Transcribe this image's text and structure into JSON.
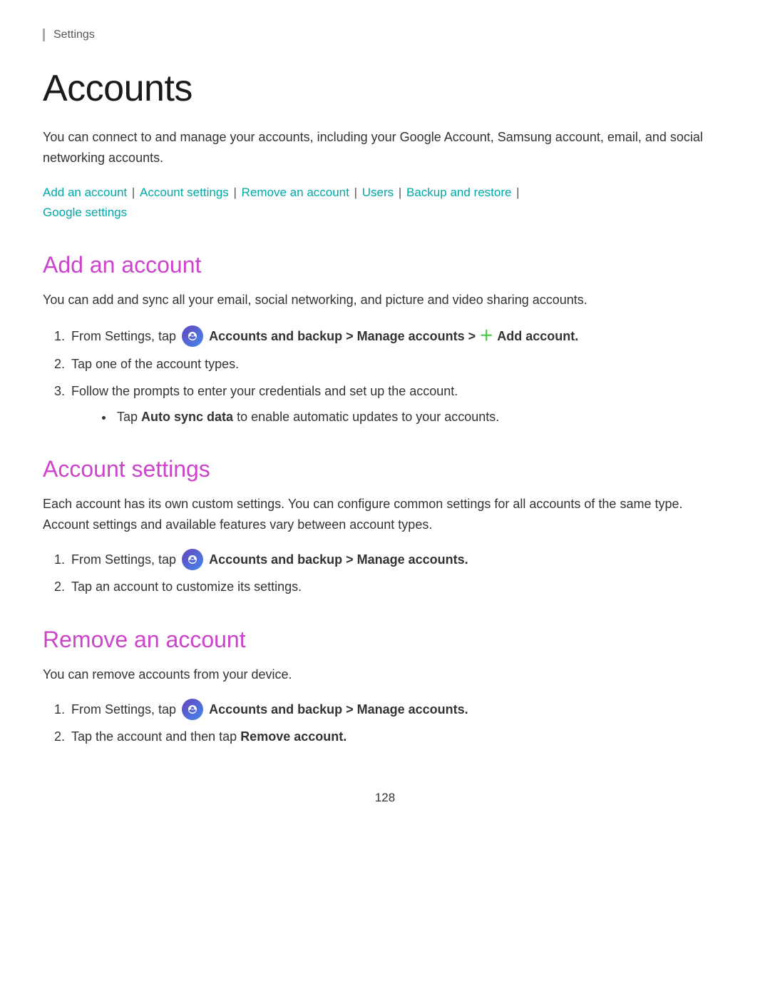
{
  "breadcrumb": "Settings",
  "page_title": "Accounts",
  "intro_text": "You can connect to and manage your accounts, including your Google Account, Samsung account, email, and social networking accounts.",
  "quick_links": {
    "items": [
      {
        "label": "Add an account",
        "href": "#add"
      },
      {
        "label": "Account settings",
        "href": "#settings"
      },
      {
        "label": "Remove an account",
        "href": "#remove"
      },
      {
        "label": "Users",
        "href": "#users"
      },
      {
        "label": "Backup and restore",
        "href": "#backup"
      },
      {
        "label": "Google settings",
        "href": "#google"
      }
    ]
  },
  "sections": [
    {
      "id": "add",
      "heading": "Add an account",
      "intro": "You can add and sync all your email, social networking, and picture and video sharing accounts.",
      "steps": [
        {
          "text_before": "From Settings, tap",
          "icon": true,
          "bold_text": "Accounts and backup > Manage accounts >",
          "plus": true,
          "plus_text": "Add account.",
          "text_after": ""
        },
        {
          "text": "Tap one of the account types."
        },
        {
          "text": "Follow the prompts to enter your credentials and set up the account.",
          "bullet": "Tap Auto sync data to enable automatic updates to your accounts."
        }
      ]
    },
    {
      "id": "settings",
      "heading": "Account settings",
      "intro": "Each account has its own custom settings. You can configure common settings for all accounts of the same type. Account settings and available features vary between account types.",
      "steps": [
        {
          "text_before": "From Settings, tap",
          "icon": true,
          "bold_text": "Accounts and backup > Manage accounts.",
          "text_after": ""
        },
        {
          "text": "Tap an account to customize its settings."
        }
      ]
    },
    {
      "id": "remove",
      "heading": "Remove an account",
      "intro": "You can remove accounts from your device.",
      "steps": [
        {
          "text_before": "From Settings, tap",
          "icon": true,
          "bold_text": "Accounts and backup > Manage accounts.",
          "text_after": ""
        },
        {
          "text_before": "Tap the account and then tap",
          "bold_text": "Remove account.",
          "text_after": ""
        }
      ]
    }
  ],
  "page_number": "128"
}
